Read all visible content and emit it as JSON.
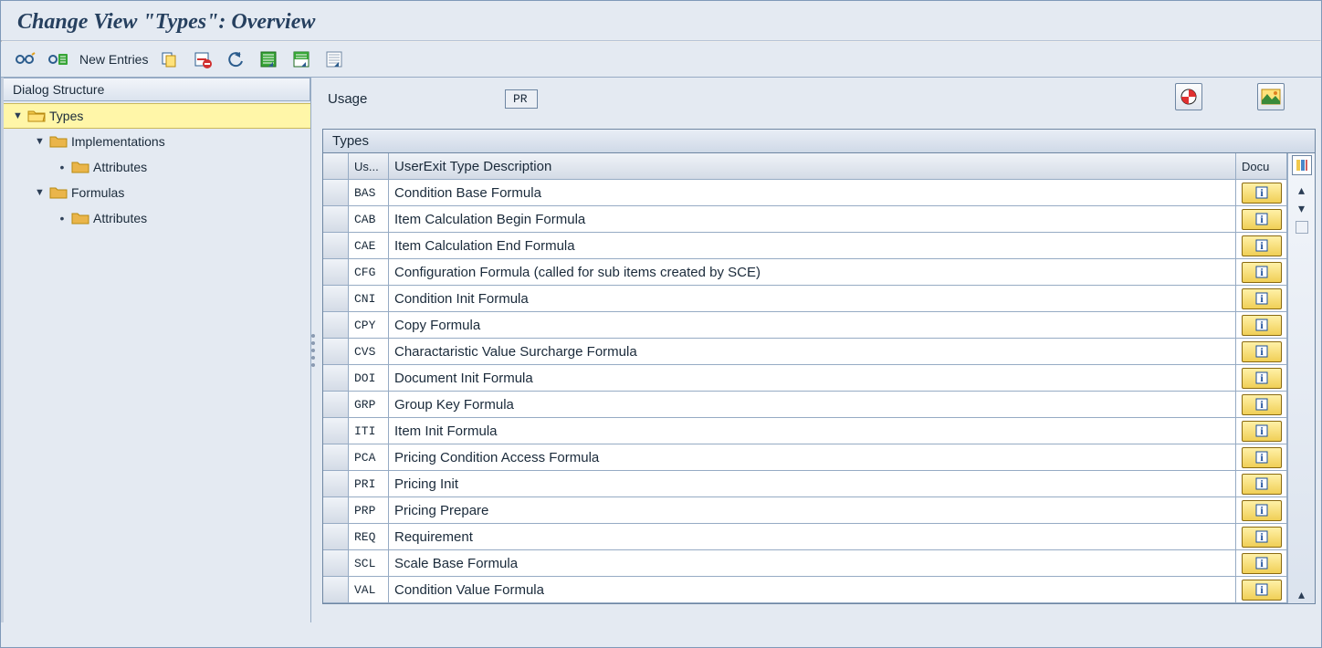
{
  "header": {
    "title": "Change View \"Types\": Overview"
  },
  "toolbar": {
    "new_entries_label": "New Entries"
  },
  "sidebar": {
    "title": "Dialog Structure",
    "nodes": {
      "types": "Types",
      "implementations": "Implementations",
      "attributes1": "Attributes",
      "formulas": "Formulas",
      "attributes2": "Attributes"
    }
  },
  "usage": {
    "label": "Usage",
    "value": "PR"
  },
  "table": {
    "title": "Types",
    "columns": {
      "us": "Us...",
      "desc": "UserExit Type Description",
      "docu": "Docu"
    },
    "rows": [
      {
        "code": "BAS",
        "desc": "Condition Base Formula"
      },
      {
        "code": "CAB",
        "desc": "Item Calculation Begin Formula"
      },
      {
        "code": "CAE",
        "desc": "Item Calculation End Formula"
      },
      {
        "code": "CFG",
        "desc": "Configuration Formula (called for sub items created by SCE)"
      },
      {
        "code": "CNI",
        "desc": "Condition Init Formula"
      },
      {
        "code": "CPY",
        "desc": "Copy Formula"
      },
      {
        "code": "CVS",
        "desc": "Charactaristic Value Surcharge Formula"
      },
      {
        "code": "DOI",
        "desc": "Document Init Formula"
      },
      {
        "code": "GRP",
        "desc": "Group Key Formula"
      },
      {
        "code": "ITI",
        "desc": "Item Init Formula"
      },
      {
        "code": "PCA",
        "desc": "Pricing Condition Access Formula"
      },
      {
        "code": "PRI",
        "desc": "Pricing Init"
      },
      {
        "code": "PRP",
        "desc": "Pricing Prepare"
      },
      {
        "code": "REQ",
        "desc": "Requirement"
      },
      {
        "code": "SCL",
        "desc": "Scale Base Formula"
      },
      {
        "code": "VAL",
        "desc": "Condition Value Formula"
      }
    ]
  }
}
